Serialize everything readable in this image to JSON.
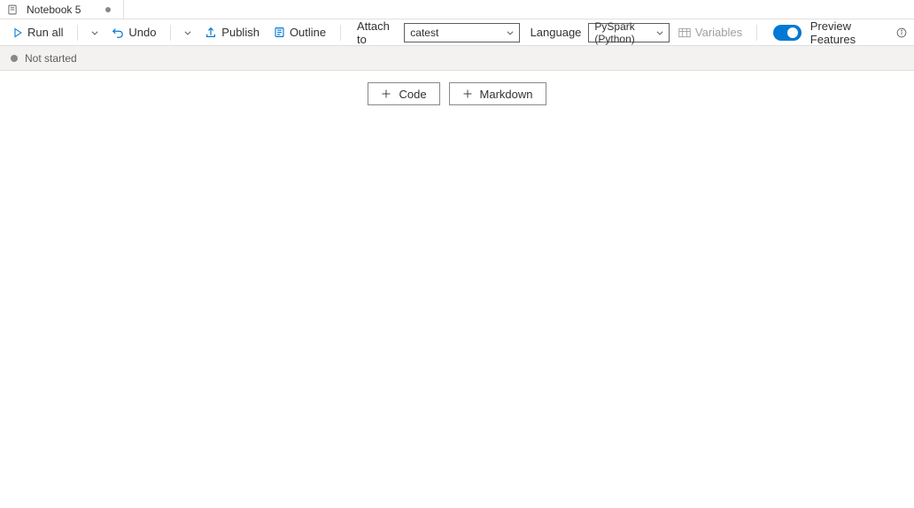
{
  "tab": {
    "title": "Notebook 5"
  },
  "toolbar": {
    "run_all": "Run all",
    "undo": "Undo",
    "publish": "Publish",
    "outline": "Outline",
    "attach_to_label": "Attach to",
    "attach_to_value": "catest",
    "language_label": "Language",
    "language_value": "PySpark (Python)",
    "variables": "Variables",
    "preview_features": "Preview Features"
  },
  "status": {
    "text": "Not started"
  },
  "content": {
    "add_code": "Code",
    "add_markdown": "Markdown"
  }
}
